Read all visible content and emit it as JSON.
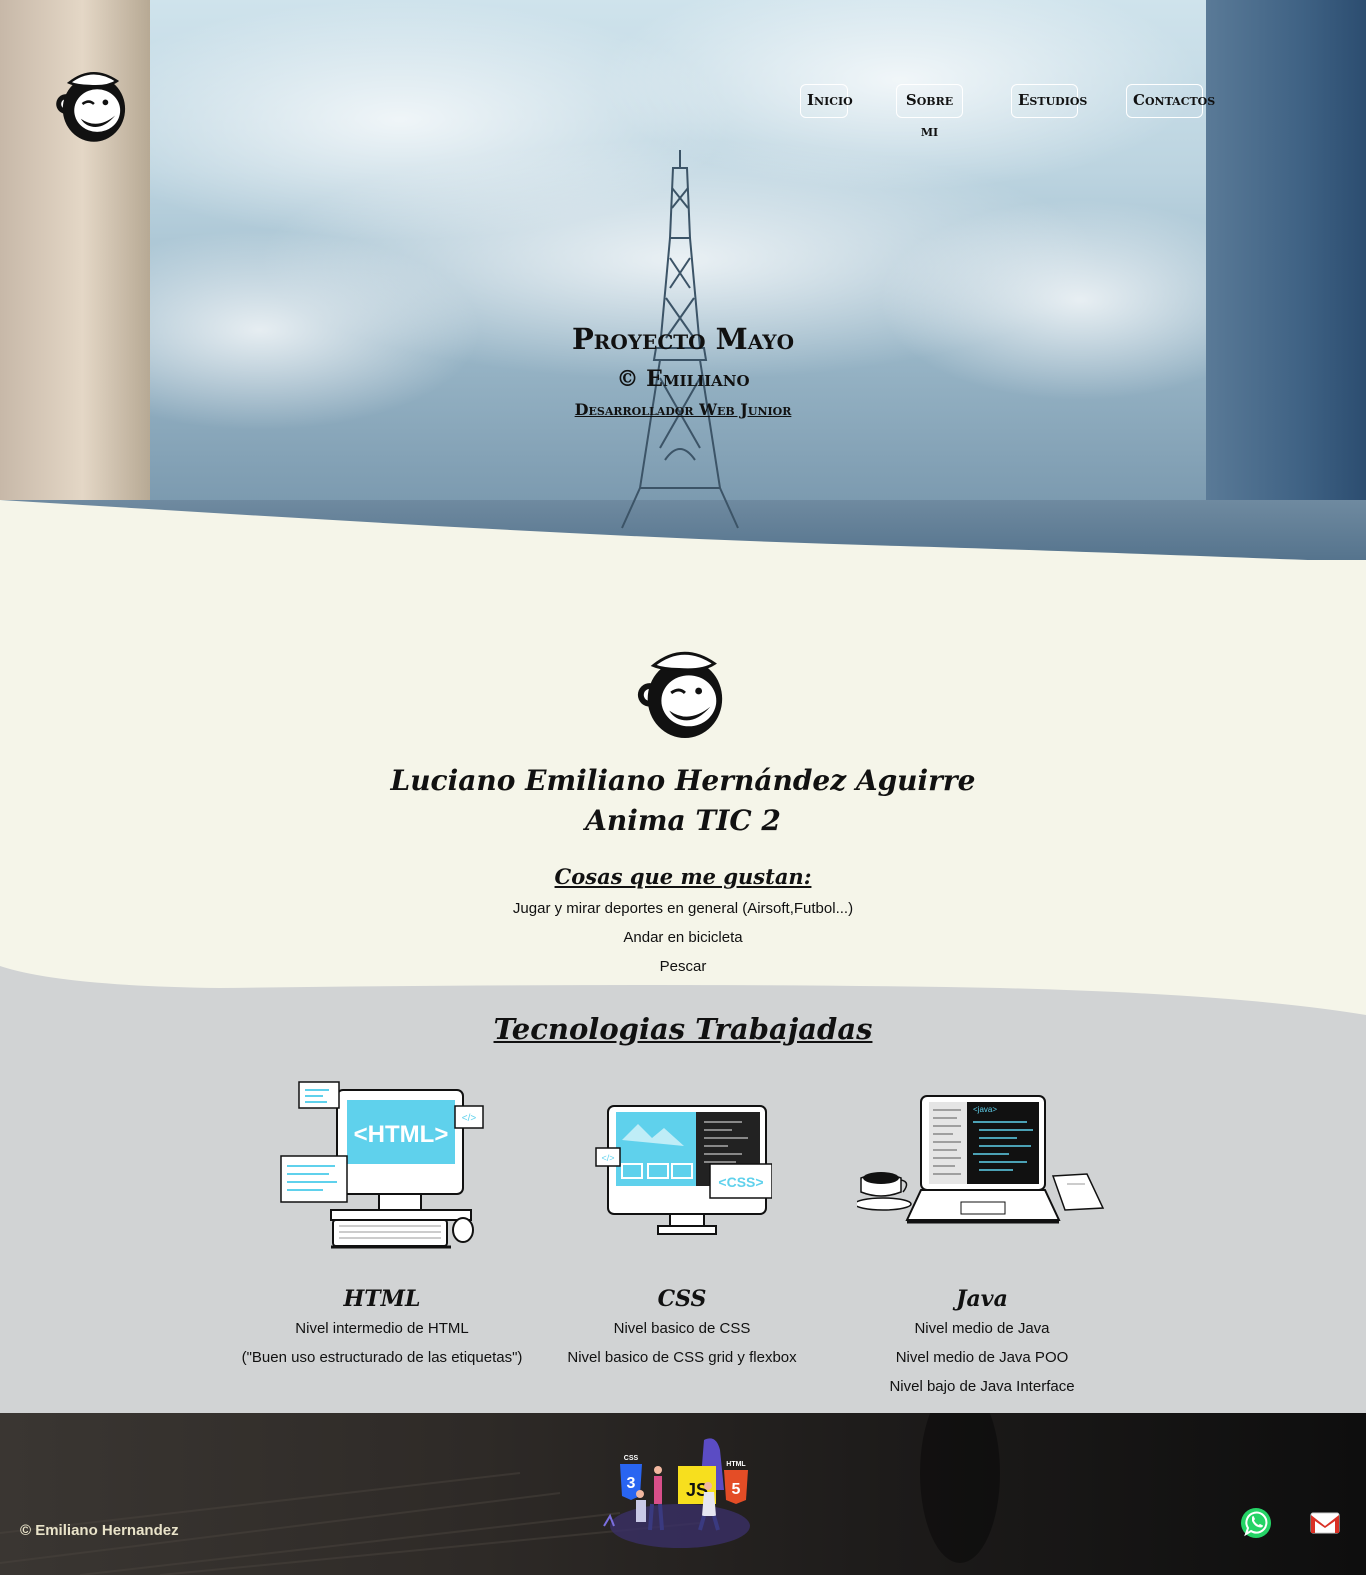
{
  "nav": {
    "items": [
      {
        "label": "Inicio"
      },
      {
        "label": "Sobre mi"
      },
      {
        "label": "Estudios"
      },
      {
        "label": "Contactos"
      }
    ]
  },
  "hero": {
    "title": "Proyecto Mayo",
    "subtitle": "© Emiliiano",
    "tagline": "Desarrollador Web Junior"
  },
  "about": {
    "name": "Luciano Emiliano Hernández Aguirre",
    "course": "Anima TIC 2",
    "likes_title": "Cosas que me gustan:",
    "likes": [
      "Jugar y mirar deportes en general (Airsoft,Futbol...)",
      "Andar en bicicleta",
      "Pescar"
    ]
  },
  "tech": {
    "title": "Tecnologias Trabajadas",
    "items": [
      {
        "name": "HTML",
        "img_text": "<HTML>",
        "lines": [
          "Nivel intermedio de HTML",
          "(\"Buen uso estructurado de las etiquetas\")"
        ]
      },
      {
        "name": "CSS",
        "img_text": "<CSS>",
        "lines": [
          "Nivel basico de CSS",
          "Nivel basico de CSS grid y flexbox"
        ]
      },
      {
        "name": "Java",
        "img_text": "<java>",
        "lines": [
          "Nivel medio de Java",
          "Nivel medio de Java POO",
          "Nivel bajo de Java Interface"
        ]
      }
    ]
  },
  "footer": {
    "copyright": "© Emiliano Hernandez",
    "art_labels": {
      "css": "CSS",
      "js": "JS",
      "html": "HTML"
    }
  },
  "colors": {
    "about_bg": "#f5f5e9",
    "tech_bg": "#d1d3d4",
    "html_screen": "#5fd1ec",
    "whatsapp": "#25d366",
    "gmail": "#d93025"
  },
  "icons": [
    "monkey-logo-icon",
    "whatsapp-icon",
    "gmail-icon"
  ]
}
